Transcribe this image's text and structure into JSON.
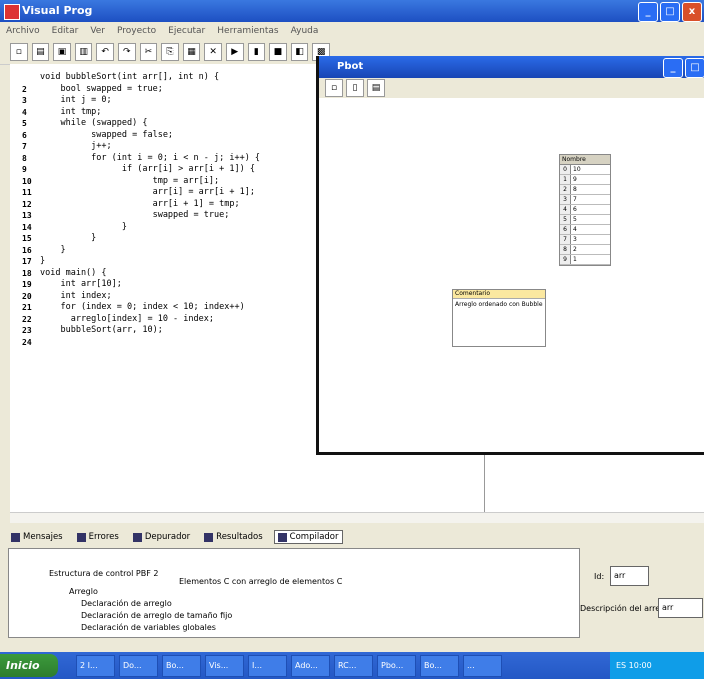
{
  "app": {
    "title": "Visual Prog"
  },
  "menu": [
    "Archivo",
    "Editar",
    "Ver",
    "Proyecto",
    "Ejecutar",
    "Herramientas",
    "Ayuda"
  ],
  "editor": {
    "lines": [
      {
        "n": "",
        "code": "void bubbleSort(int arr[], int n) {"
      },
      {
        "n": "2",
        "code": "    bool swapped = true;"
      },
      {
        "n": "3",
        "code": "    int j = 0;"
      },
      {
        "n": "4",
        "code": "    int tmp;"
      },
      {
        "n": "5",
        "code": "    while (swapped) {"
      },
      {
        "n": "6",
        "code": "          swapped = false;"
      },
      {
        "n": "7",
        "code": "          j++;"
      },
      {
        "n": "8",
        "code": "          for (int i = 0; i < n - j; i++) {"
      },
      {
        "n": "9",
        "code": "                if (arr[i] > arr[i + 1]) {"
      },
      {
        "n": "10",
        "code": "                      tmp = arr[i];"
      },
      {
        "n": "11",
        "code": "                      arr[i] = arr[i + 1];"
      },
      {
        "n": "12",
        "code": "                      arr[i + 1] = tmp;"
      },
      {
        "n": "13",
        "code": "                      swapped = true;"
      },
      {
        "n": "14",
        "code": "                }"
      },
      {
        "n": "15",
        "code": "          }"
      },
      {
        "n": "16",
        "code": "    }"
      },
      {
        "n": "17",
        "code": "}"
      },
      {
        "n": "18",
        "code": "void main() {"
      },
      {
        "n": "19",
        "code": "    int arr[10];"
      },
      {
        "n": "20",
        "code": "    int index;"
      },
      {
        "n": "21",
        "code": "    for (index = 0; index < 10; index++)"
      },
      {
        "n": "22",
        "code": "      arreglo[index] = 10 - index;"
      },
      {
        "n": "23",
        "code": "    bubbleSort(arr, 10);"
      },
      {
        "n": "24",
        "code": ""
      }
    ]
  },
  "tabs": [
    "Mensajes",
    "Errores",
    "Depurador",
    "Resultados",
    "Compilador"
  ],
  "output": {
    "rows": [
      "Estructura de control PBF 2",
      "Elementos C con arreglo de elementos C",
      "Arreglo",
      "Declaración de arreglo",
      "Declaración de arreglo de tamaño fijo",
      "Declaración de variables globales"
    ]
  },
  "side": {
    "label1": "Id:",
    "value1": "arr",
    "label2": "Descripción del arreglo:",
    "value2": "arr"
  },
  "pbot": {
    "title": "Pbot",
    "table": {
      "header": "Nombre",
      "rows": [
        {
          "i": "0",
          "v": "10"
        },
        {
          "i": "1",
          "v": "9"
        },
        {
          "i": "2",
          "v": "8"
        },
        {
          "i": "3",
          "v": "7"
        },
        {
          "i": "4",
          "v": "6"
        },
        {
          "i": "5",
          "v": "5"
        },
        {
          "i": "6",
          "v": "4"
        },
        {
          "i": "7",
          "v": "3"
        },
        {
          "i": "8",
          "v": "2"
        },
        {
          "i": "9",
          "v": "1"
        }
      ]
    },
    "note": {
      "header": "Comentario",
      "body": "Arreglo ordenado con Bubble"
    }
  },
  "taskbar": {
    "start": "Inicio",
    "tasks": [
      "2 I...",
      "Do...",
      "Bo...",
      "Vis...",
      "I...",
      "Ado...",
      "RC...",
      "Pbo...",
      "Bo...",
      "..."
    ],
    "tray": "ES 10:00"
  }
}
